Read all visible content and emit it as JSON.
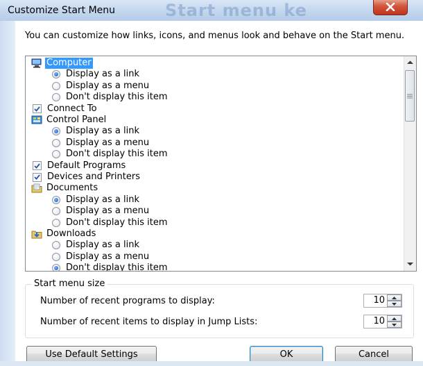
{
  "window": {
    "title": "Customize Start Menu",
    "background_title_text": "Start menu ke"
  },
  "intro": "You can customize how links, icons, and menus look and behave on the Start menu.",
  "list": {
    "items": [
      {
        "kind": "category",
        "label": "Computer",
        "icon": "computer-icon",
        "selected": true
      },
      {
        "kind": "radio",
        "label": "Display as a link",
        "checked": true
      },
      {
        "kind": "radio",
        "label": "Display as a menu",
        "checked": false
      },
      {
        "kind": "radio",
        "label": "Don't display this item",
        "checked": false
      },
      {
        "kind": "checkbox",
        "label": "Connect To",
        "checked": true
      },
      {
        "kind": "category",
        "label": "Control Panel",
        "icon": "control-panel-icon",
        "selected": false
      },
      {
        "kind": "radio",
        "label": "Display as a link",
        "checked": true
      },
      {
        "kind": "radio",
        "label": "Display as a menu",
        "checked": false
      },
      {
        "kind": "radio",
        "label": "Don't display this item",
        "checked": false
      },
      {
        "kind": "checkbox",
        "label": "Default Programs",
        "checked": true
      },
      {
        "kind": "checkbox",
        "label": "Devices and Printers",
        "checked": true
      },
      {
        "kind": "category",
        "label": "Documents",
        "icon": "documents-icon",
        "selected": false
      },
      {
        "kind": "radio",
        "label": "Display as a link",
        "checked": true
      },
      {
        "kind": "radio",
        "label": "Display as a menu",
        "checked": false
      },
      {
        "kind": "radio",
        "label": "Don't display this item",
        "checked": false
      },
      {
        "kind": "category",
        "label": "Downloads",
        "icon": "downloads-icon",
        "selected": false
      },
      {
        "kind": "radio",
        "label": "Display as a link",
        "checked": false
      },
      {
        "kind": "radio",
        "label": "Display as a menu",
        "checked": false
      },
      {
        "kind": "radio",
        "label": "Don't display this item",
        "checked": true
      }
    ]
  },
  "size_group": {
    "legend": "Start menu size",
    "recent_programs_label": "Number of recent programs to display:",
    "recent_programs_value": "10",
    "jump_list_label": "Number of recent items to display in Jump Lists:",
    "jump_list_value": "10"
  },
  "buttons": {
    "defaults": "Use Default Settings",
    "ok": "OK",
    "cancel": "Cancel"
  },
  "colors": {
    "selection": "#3399ff",
    "close_button": "#c0341c",
    "title_bar": "#c3d6ee"
  }
}
